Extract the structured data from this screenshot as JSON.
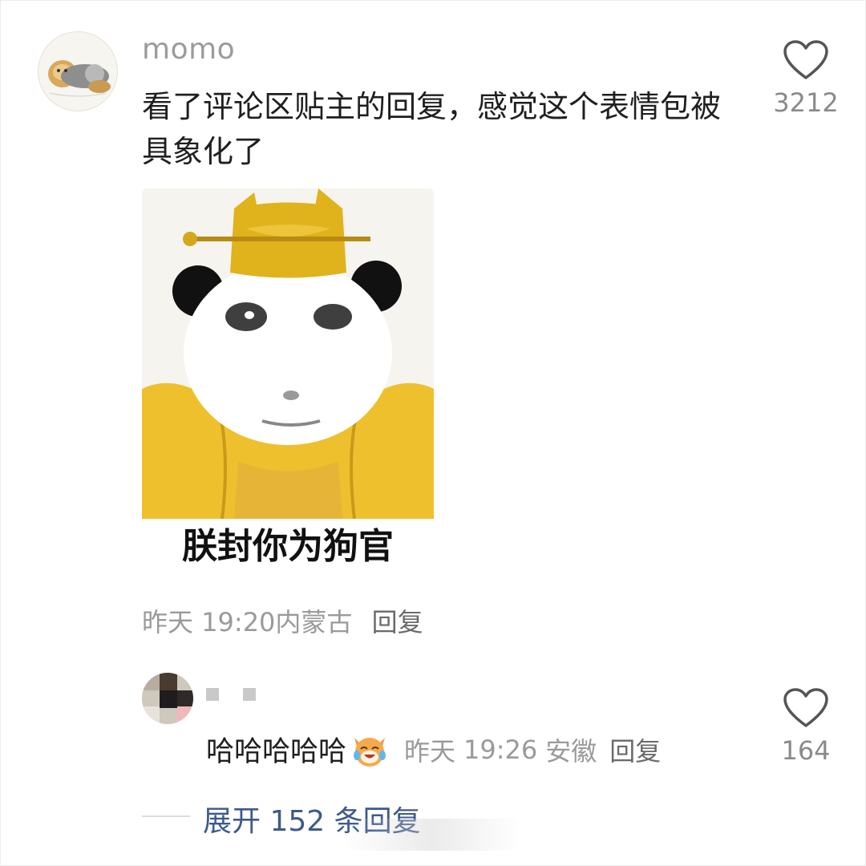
{
  "comment": {
    "username": "momo",
    "text": "看了评论区贴主的回复，感觉这个表情包被具象化了",
    "sticker_caption": "朕封你为狗官",
    "date": "昨天",
    "time": "19:20",
    "location": "内蒙古",
    "reply_label": "回复",
    "like_count": "3212"
  },
  "reply": {
    "text": "哈哈哈哈哈",
    "date": "昨天",
    "time": "19:26",
    "location": "安徽",
    "reply_label": "回复",
    "like_count": "164"
  },
  "expand": {
    "label": "展开 152 条回复"
  },
  "colors": {
    "text_primary": "#1f1f1f",
    "text_secondary": "#9a9a9a",
    "link": "#3d5a8a",
    "hat_gold": "#e0b21c",
    "robe_yellow": "#efc02e"
  },
  "icons": [
    "heart-outline-icon",
    "laughing-cat-emoji"
  ]
}
